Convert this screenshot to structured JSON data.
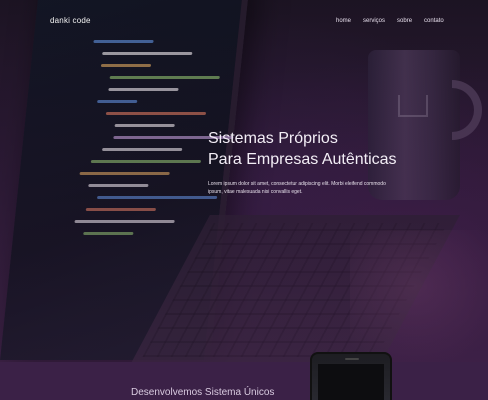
{
  "header": {
    "logo": "danki code",
    "nav": [
      {
        "label": "home"
      },
      {
        "label": "serviços"
      },
      {
        "label": "sobre"
      },
      {
        "label": "contato"
      }
    ]
  },
  "hero": {
    "title_line1": "Sistemas Próprios",
    "title_line2": "Para Empresas Autênticas",
    "description": "Lorem ipsum dolor sit amet, consectetur adipiscing elit. Morbi eleifend commodo ipsum, vitae malesuada nisi convallis eget."
  },
  "section": {
    "title": "Desenvolvemos Sistema Únicos"
  },
  "colors": {
    "section_bg": "#3b2147",
    "text_light": "#f3eef6"
  }
}
